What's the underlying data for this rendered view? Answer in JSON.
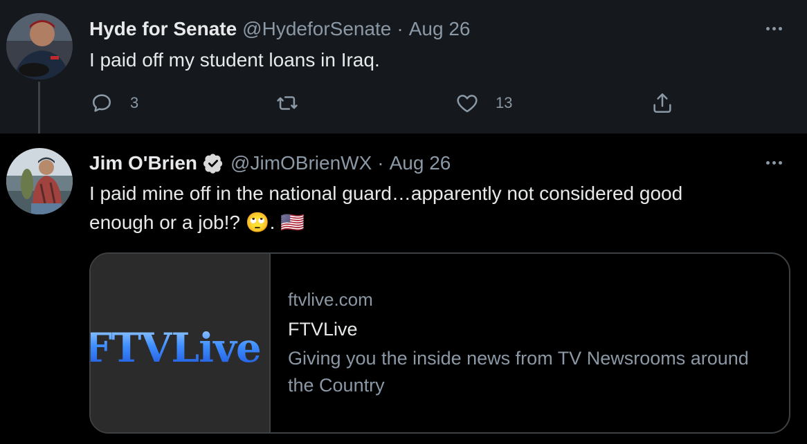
{
  "tweets": [
    {
      "display_name": "Hyde for Senate",
      "handle": "@HydeforSenate",
      "separator": "·",
      "date": "Aug 26",
      "text": "I paid off my student loans in Iraq.",
      "actions": {
        "reply_count": "3",
        "retweet_count": "",
        "like_count": "13"
      }
    },
    {
      "display_name": "Jim O'Brien",
      "handle": "@JimOBrienWX",
      "separator": "·",
      "date": "Aug 26",
      "text_line1": "I paid mine off in the national guard…apparently not considered good",
      "text_line2": "enough or a job!? 🙄. 🇺🇸",
      "card": {
        "thumbnail_text": "FTVLive",
        "domain": "ftvlive.com",
        "title": "FTVLive",
        "description": "Giving you the inside news from TV Newsrooms around the Country"
      }
    }
  ],
  "icons": {
    "reply": "reply-icon",
    "retweet": "retweet-icon",
    "like": "heart-icon",
    "share": "share-icon",
    "more": "more-icon",
    "verified": "verified-badge-icon"
  },
  "colors": {
    "background": "#000000",
    "parent_tweet_background": "#15181c",
    "primary_text": "#e7e9ea",
    "secondary_text": "#8b98a5",
    "border": "#3e4144"
  }
}
